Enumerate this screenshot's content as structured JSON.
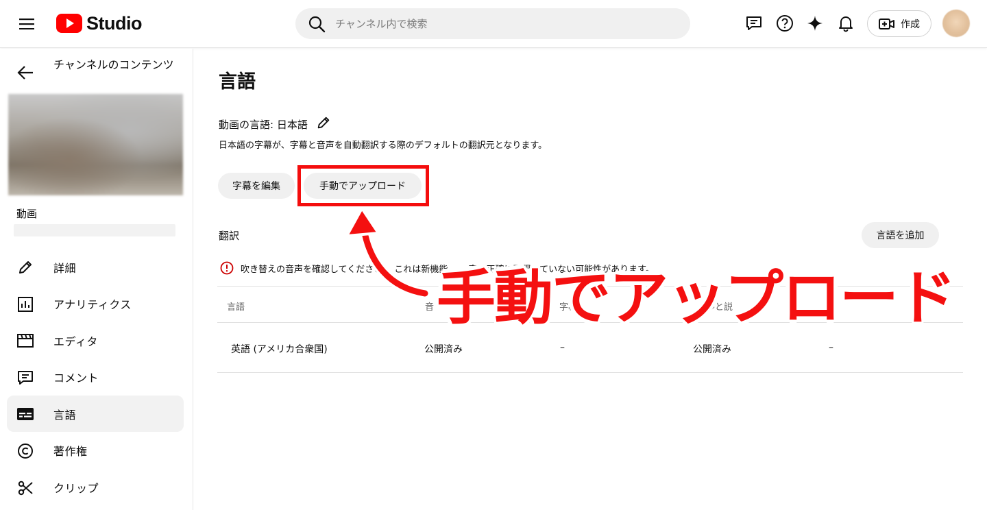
{
  "header": {
    "logo_text": "Studio",
    "search_placeholder": "チャンネル内で検索",
    "create_label": "作成",
    "colors": {
      "brand": "#ff0000"
    }
  },
  "sidebar": {
    "back_label": "チャンネルのコンテンツ",
    "video_label": "動画",
    "items": [
      {
        "label": "詳細",
        "icon": "pencil-icon"
      },
      {
        "label": "アナリティクス",
        "icon": "analytics-icon"
      },
      {
        "label": "エディタ",
        "icon": "clapperboard-icon"
      },
      {
        "label": "コメント",
        "icon": "comment-icon"
      },
      {
        "label": "言語",
        "icon": "subtitles-icon",
        "active": true
      },
      {
        "label": "著作権",
        "icon": "copyright-icon"
      },
      {
        "label": "クリップ",
        "icon": "scissors-icon"
      }
    ]
  },
  "main": {
    "title": "言語",
    "video_language_label": "動画の言語: 日本語",
    "video_language_desc": "日本語の字幕が、字幕と音声を自動翻訳する際のデフォルトの翻訳元となります。",
    "edit_subtitles_label": "字幕を編集",
    "manual_upload_label": "手動でアップロード",
    "translations_title": "翻訳",
    "add_language_label": "言語を追加",
    "warning_text": "吹き替えの音声を確認してください。 これは新機能… …声を正確に再現していない可能性があります。",
    "table": {
      "headers": [
        "言語",
        "音",
        "字幕",
        "…ルと説",
        ""
      ],
      "rows": [
        {
          "language": "英語 (アメリカ合衆国)",
          "audio": "公開済み",
          "subtitles": "–",
          "title_desc": "公開済み",
          "extra": "–"
        }
      ]
    }
  },
  "annotation": {
    "text": "手動でアップロード",
    "color": "#f41010"
  }
}
